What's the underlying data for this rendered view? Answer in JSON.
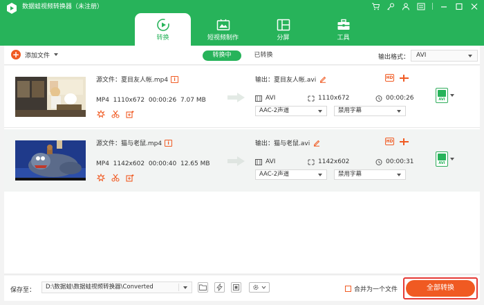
{
  "app": {
    "title": "数据蛙视频转换器（未注册）"
  },
  "nav_tabs": [
    {
      "label": "转换",
      "icon": "convert-icon",
      "active": true
    },
    {
      "label": "短视频制作",
      "icon": "short-video-icon",
      "active": false
    },
    {
      "label": "分屏",
      "icon": "split-screen-icon",
      "active": false
    },
    {
      "label": "工具",
      "icon": "toolbox-icon",
      "active": false
    }
  ],
  "toolbar": {
    "add_file_label": "添加文件",
    "converting_label": "转换中",
    "converted_label": "已转换",
    "output_format_label": "输出格式：",
    "output_format_value": "AVI"
  },
  "files": [
    {
      "source_label": "源文件：",
      "source_name": "夏目友人帐.mp4",
      "format": "MP4",
      "resolution": "1110x672",
      "duration": "00:00:26",
      "size": "7.07 MB",
      "output_label": "输出：",
      "output_name": "夏目友人帐.avi",
      "out_format": "AVI",
      "out_resolution": "1110x672",
      "out_duration": "00:00:26",
      "audio": "AAC-2声道",
      "subtitle": "禁用字幕",
      "format_badge": "AVI"
    },
    {
      "source_label": "源文件：",
      "source_name": "猫与老鼠.mp4",
      "format": "MP4",
      "resolution": "1142x602",
      "duration": "00:00:40",
      "size": "12.65 MB",
      "output_label": "输出：",
      "output_name": "猫与老鼠.avi",
      "out_format": "AVI",
      "out_resolution": "1142x602",
      "out_duration": "00:00:31",
      "audio": "AAC-2声道",
      "subtitle": "禁用字幕",
      "format_badge": "AVI"
    }
  ],
  "bottom": {
    "save_to_label": "保存至：",
    "save_path": "D:\\数据蛙\\数据蛙视频转换器\\Converted",
    "merge_label": "合并为一个文件",
    "convert_all_label": "全部转换"
  },
  "colors": {
    "brand_green": "#27b35a",
    "accent_orange": "#f05a22",
    "highlight_red": "#e53935"
  }
}
